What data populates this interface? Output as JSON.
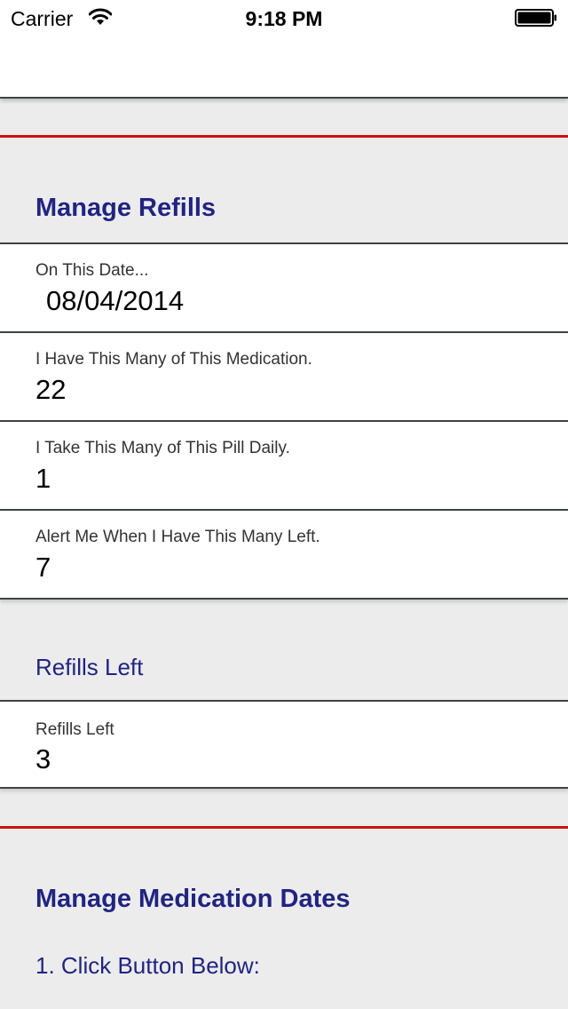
{
  "status_bar": {
    "carrier": "Carrier",
    "time": "9:18 PM"
  },
  "colors": {
    "background": "#ececec",
    "heading": "#1f2485",
    "divider": "#3d4444",
    "accent_rule": "#cc1111"
  },
  "manage_refills": {
    "title": "Manage Refills",
    "rows": [
      {
        "label": "On This Date...",
        "value": "08/04/2014"
      },
      {
        "label": "I Have This Many of This Medication.",
        "value": "22"
      },
      {
        "label": "I Take This Many of This Pill Daily.",
        "value": "1"
      },
      {
        "label": "Alert Me When I Have This Many Left.",
        "value": "7"
      }
    ]
  },
  "refills_left": {
    "title": "Refills Left",
    "label": "Refills Left",
    "value": "3"
  },
  "manage_dates": {
    "title": "Manage Medication Dates",
    "step": "1. Click Button Below:"
  }
}
